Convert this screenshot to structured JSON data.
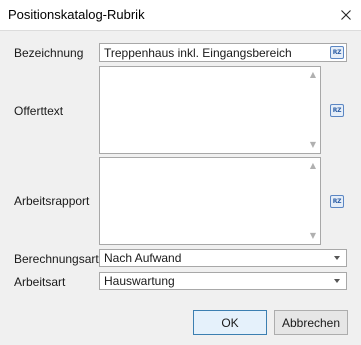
{
  "window": {
    "title": "Positionskatalog-Rubrik"
  },
  "icons": {
    "close": "close-icon",
    "rz": "rz-icon",
    "dropdown": "chevron-down-icon"
  },
  "fields": {
    "bezeichnung": {
      "label": "Bezeichnung",
      "value": "Treppenhaus inkl. Eingangsbereich"
    },
    "offerttext": {
      "label": "Offerttext",
      "value": ""
    },
    "arbeitsrapport": {
      "label": "Arbeitsrapport",
      "value": ""
    },
    "berechnungsart": {
      "label": "Berechnungsart",
      "value": "Nach Aufwand"
    },
    "arbeitsart": {
      "label": "Arbeitsart",
      "value": "Hauswartung"
    }
  },
  "rz_label": "RZ",
  "buttons": {
    "ok": "OK",
    "cancel": "Abbrechen"
  },
  "colors": {
    "accent": "#3c7fb1",
    "rz_icon": "#2e5fa6",
    "client_bg": "#f0f0f0"
  }
}
